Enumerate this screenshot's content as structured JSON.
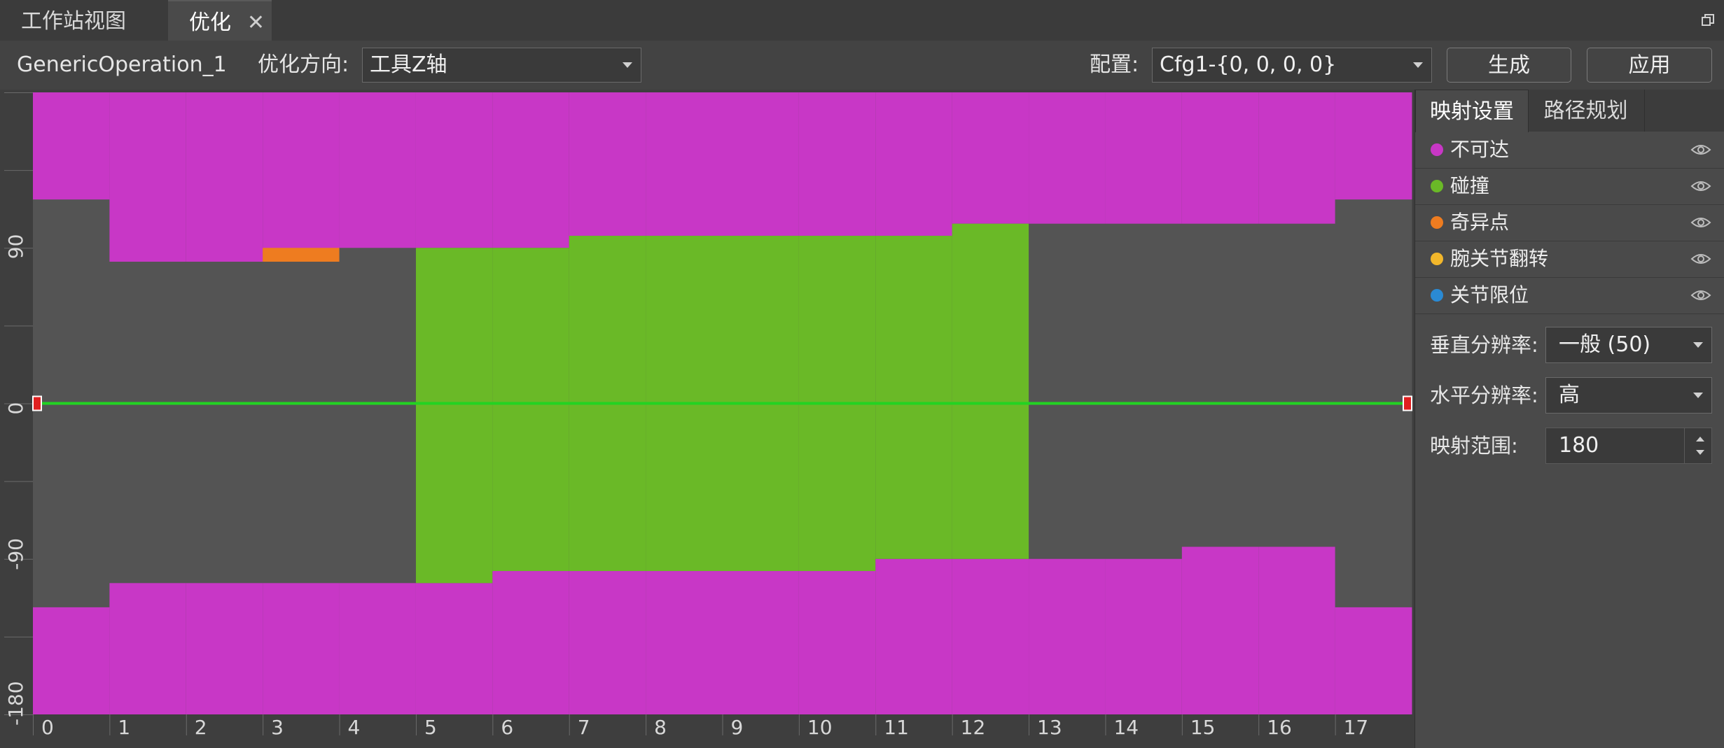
{
  "tabs": {
    "workstation": "工作站视图",
    "optimize": "优化",
    "close": "✕"
  },
  "toolbar": {
    "operation": "GenericOperation_1",
    "direction_label": "优化方向:",
    "direction_value": "工具Z轴",
    "config_label": "配置:",
    "config_value": "Cfg1-{0, 0, 0, 0}",
    "generate_button": "生成",
    "apply_button": "应用"
  },
  "side": {
    "tabs": [
      "映射设置",
      "路径规划"
    ],
    "legend": [
      {
        "label": "不可达",
        "color": "#c837c6"
      },
      {
        "label": "碰撞",
        "color": "#6ab927"
      },
      {
        "label": "奇异点",
        "color": "#ee7c20"
      },
      {
        "label": "腕关节翻转",
        "color": "#f2b72b"
      },
      {
        "label": "关节限位",
        "color": "#2a8ad4"
      }
    ],
    "vertical_res_label": "垂直分辨率:",
    "vertical_res_value": "一般 (50)",
    "horizontal_res_label": "水平分辨率:",
    "horizontal_res_value": "高",
    "range_label": "映射范围:",
    "range_value": "180"
  },
  "chart_data": {
    "type": "heatmap",
    "x_ticks": [
      "0",
      "1",
      "2",
      "3",
      "4",
      "5",
      "6",
      "7",
      "8",
      "9",
      "10",
      "11",
      "12",
      "13",
      "14",
      "15",
      "16",
      "17"
    ],
    "y_ticks": [
      "90",
      "0",
      "-90",
      "-180"
    ],
    "xlim": [
      0,
      18
    ],
    "ylim": [
      -180,
      180
    ],
    "colors": {
      "unreachable": "#c837c6",
      "collision": "#6ab927",
      "singularity": "#ee7c20",
      "ok": "#545454",
      "path": "#22d322"
    },
    "columns": [
      {
        "x": 0,
        "top": 118,
        "bottom": -118
      },
      {
        "x": 1,
        "top": 82,
        "bottom": -104
      },
      {
        "x": 2,
        "top": 82,
        "bottom": -104
      },
      {
        "x": 3,
        "top": 82,
        "bottom": -104,
        "singularity": [
          82,
          90
        ]
      },
      {
        "x": 4,
        "top": 90,
        "bottom": -104
      },
      {
        "x": 5,
        "top": 90,
        "bottom": -104,
        "collision": [
          90,
          -104
        ]
      },
      {
        "x": 6,
        "top": 90,
        "bottom": -97,
        "collision": [
          90,
          -97
        ]
      },
      {
        "x": 7,
        "top": 97,
        "bottom": -97,
        "collision": [
          97,
          -97
        ]
      },
      {
        "x": 8,
        "top": 97,
        "bottom": -97,
        "collision": [
          97,
          -97
        ]
      },
      {
        "x": 9,
        "top": 97,
        "bottom": -97,
        "collision": [
          97,
          -97
        ]
      },
      {
        "x": 10,
        "top": 97,
        "bottom": -97,
        "collision": [
          97,
          -97
        ]
      },
      {
        "x": 11,
        "top": 97,
        "bottom": -90,
        "collision": [
          97,
          -90
        ]
      },
      {
        "x": 12,
        "top": 104,
        "bottom": -90,
        "collision": [
          104,
          -90
        ]
      },
      {
        "x": 13,
        "top": 104,
        "bottom": -90
      },
      {
        "x": 14,
        "top": 104,
        "bottom": -90
      },
      {
        "x": 15,
        "top": 104,
        "bottom": -83
      },
      {
        "x": 16,
        "top": 104,
        "bottom": -83
      },
      {
        "x": 17,
        "top": 118,
        "bottom": -118
      }
    ],
    "path_y": 0
  }
}
